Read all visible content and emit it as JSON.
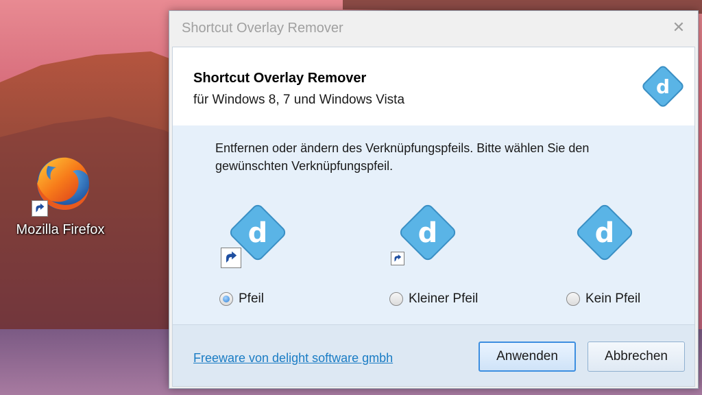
{
  "desktop": {
    "icon_label": "Mozilla Firefox"
  },
  "window": {
    "title": "Shortcut Overlay Remover",
    "close_glyph": "✕"
  },
  "header": {
    "title": "Shortcut Overlay Remover",
    "subtitle": "für Windows 8, 7 und Windows Vista",
    "logo_letter": "d"
  },
  "description": "Entfernen oder ändern des Verknüpfungspfeils. Bitte wählen Sie den gewünschten Verknüpfungspfeil.",
  "options": [
    {
      "label": "Pfeil",
      "checked": true,
      "logo_letter": "d"
    },
    {
      "label": "Kleiner Pfeil",
      "checked": false,
      "logo_letter": "d"
    },
    {
      "label": "Kein Pfeil",
      "checked": false,
      "logo_letter": "d"
    }
  ],
  "footer": {
    "link_text": "Freeware von delight software gmbh",
    "apply_label": "Anwenden",
    "cancel_label": "Abbrechen"
  },
  "colors": {
    "accent": "#3c8ee0",
    "logo_blue": "#5ab4e6",
    "link": "#1a7cc4"
  }
}
